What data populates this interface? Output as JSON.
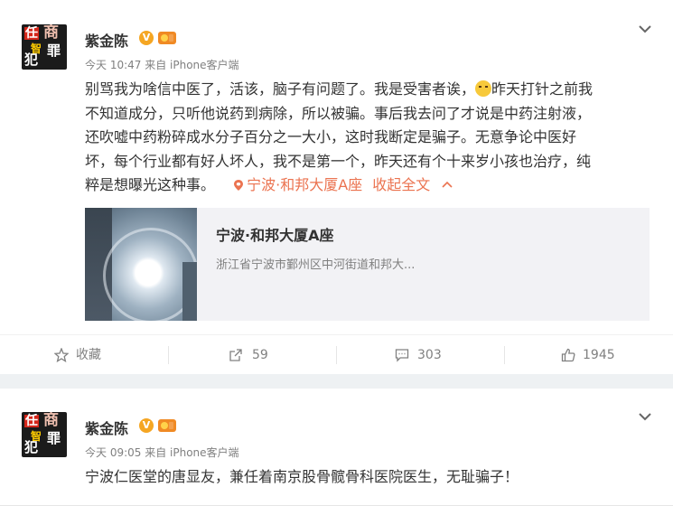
{
  "post1": {
    "author": "紫金陈",
    "verified_badge": "V",
    "meta": "今天 10:47 来自 iPhone客户端",
    "text": {
      "line1_a": "别骂我为啥信中医了，活该，脑子有问题了。我是受害者诶，",
      "line1_b": "昨天打针之前我",
      "line2": "不知道成分，只听他说药到病除，所以被骗。事后我去问了才说是中药注射液，",
      "line3": "还吹嘘中药粉碎成水分子百分之一大小，这时我断定是骗子。无意争论中医好",
      "line4": "坏，每个行业都有好人坏人，我不是第一个，昨天还有个十来岁小孩也治疗，纯",
      "line5": "粹是想曝光这种事。"
    },
    "location": "宁波·和邦大厦A座",
    "collapse_label": "收起全文",
    "emoji_icon": "crying-emoji",
    "place_card": {
      "title": "宁波·和邦大厦A座",
      "address": "浙江省宁波市鄞州区中河街道和邦大..."
    },
    "actions": {
      "favorite": "收藏",
      "repost": "59",
      "comment": "303",
      "like": "1945"
    }
  },
  "post2": {
    "author": "紫金陈",
    "verified_badge": "V",
    "meta": "今天 09:05 来自 iPhone客户端",
    "text": "宁波仁医堂的唐显友，兼任着南京股骨髋骨科医院医生，无耻骗子！"
  },
  "avatar_text": [
    "任",
    "商",
    "智",
    "罪",
    "犯"
  ],
  "colors": {
    "accent": "#eb7350",
    "muted": "#808080",
    "background": "#eef1f3"
  }
}
